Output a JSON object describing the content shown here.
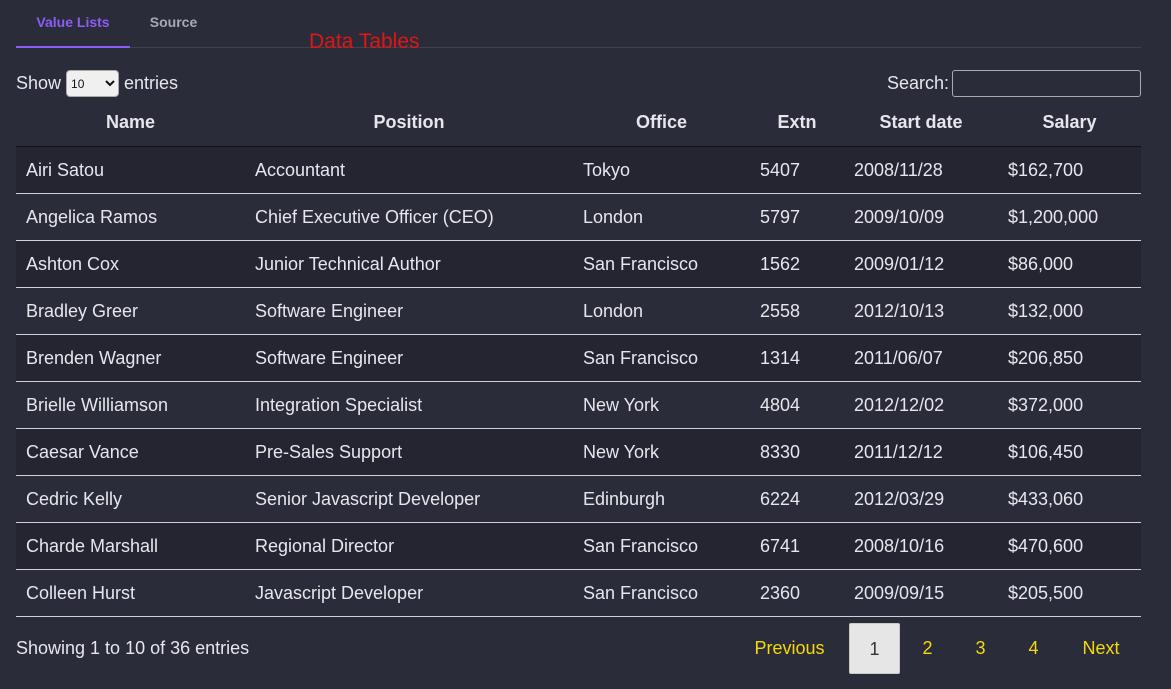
{
  "tabs": [
    {
      "label": "Value Lists",
      "active": true
    },
    {
      "label": "Source",
      "active": false
    }
  ],
  "overlay_title": "Data Tables",
  "length": {
    "prefix": "Show",
    "selected": "10",
    "suffix": "entries"
  },
  "search": {
    "label": "Search:",
    "value": ""
  },
  "table": {
    "headers": [
      "Name",
      "Position",
      "Office",
      "Extn",
      "Start date",
      "Salary"
    ],
    "rows": [
      [
        "Airi Satou",
        "Accountant",
        "Tokyo",
        "5407",
        "2008/11/28",
        "$162,700"
      ],
      [
        "Angelica Ramos",
        "Chief Executive Officer (CEO)",
        "London",
        "5797",
        "2009/10/09",
        "$1,200,000"
      ],
      [
        "Ashton Cox",
        "Junior Technical Author",
        "San Francisco",
        "1562",
        "2009/01/12",
        "$86,000"
      ],
      [
        "Bradley Greer",
        "Software Engineer",
        "London",
        "2558",
        "2012/10/13",
        "$132,000"
      ],
      [
        "Brenden Wagner",
        "Software Engineer",
        "San Francisco",
        "1314",
        "2011/06/07",
        "$206,850"
      ],
      [
        "Brielle Williamson",
        "Integration Specialist",
        "New York",
        "4804",
        "2012/12/02",
        "$372,000"
      ],
      [
        "Caesar Vance",
        "Pre-Sales Support",
        "New York",
        "8330",
        "2011/12/12",
        "$106,450"
      ],
      [
        "Cedric Kelly",
        "Senior Javascript Developer",
        "Edinburgh",
        "6224",
        "2012/03/29",
        "$433,060"
      ],
      [
        "Charde Marshall",
        "Regional Director",
        "San Francisco",
        "6741",
        "2008/10/16",
        "$470,600"
      ],
      [
        "Colleen Hurst",
        "Javascript Developer",
        "San Francisco",
        "2360",
        "2009/09/15",
        "$205,500"
      ]
    ]
  },
  "info": "Showing 1 to 10 of 36 entries",
  "pagination": {
    "previous": "Previous",
    "pages": [
      "1",
      "2",
      "3",
      "4"
    ],
    "current": "1",
    "next": "Next"
  },
  "colors": {
    "background": "#2b2c3a",
    "accent": "#8b5cf6",
    "overlay_title": "#e01515",
    "pager_link": "#f5d90a"
  }
}
